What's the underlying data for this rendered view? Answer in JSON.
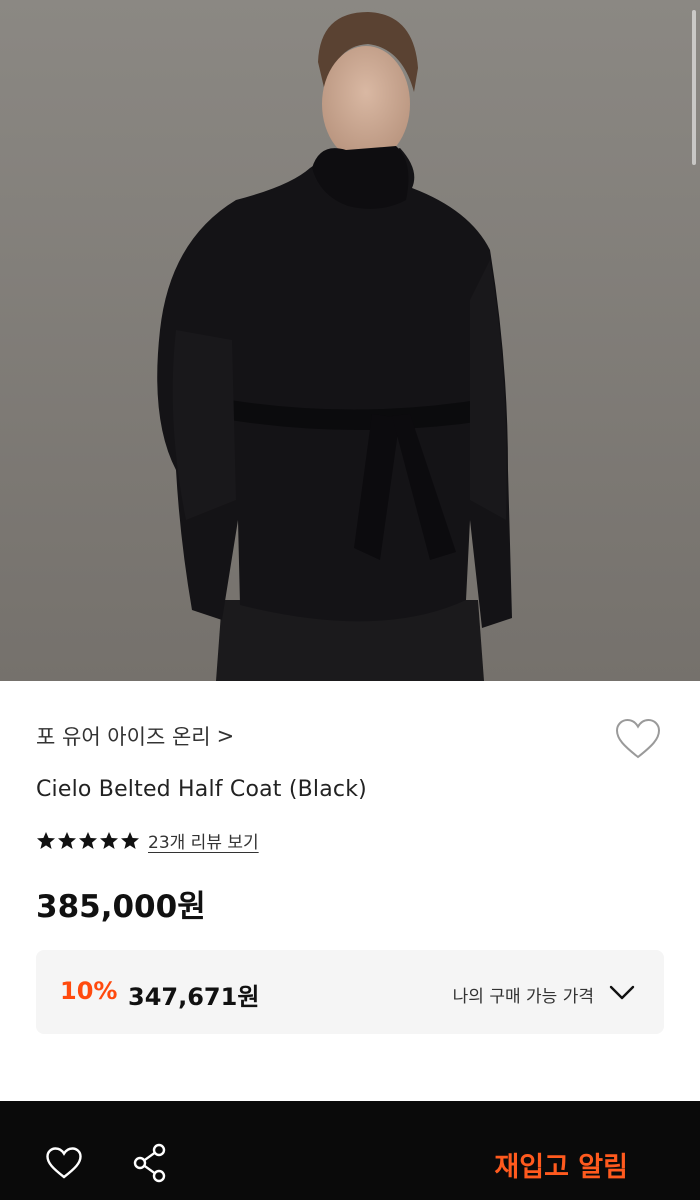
{
  "product": {
    "brand": "포 유어 아이즈 온리",
    "brand_chevron": ">",
    "name": "Cielo Belted Half Coat (Black)",
    "rating_stars": 5,
    "review_link": "23개 리뷰 보기",
    "price": "385,000원",
    "discount": {
      "rate": "10%",
      "price": "347,671원",
      "label": "나의 구매 가능 가격"
    }
  },
  "bottom_bar": {
    "restock_label": "재입고 알림"
  },
  "icons": {
    "wish": "heart-outline-icon",
    "share": "share-icon",
    "expand": "chevron-down-icon",
    "star": "star-icon"
  },
  "colors": {
    "accent": "#ff4a0e",
    "bottom_bar": "#0a0a0a",
    "discount_box": "#f5f5f5"
  }
}
